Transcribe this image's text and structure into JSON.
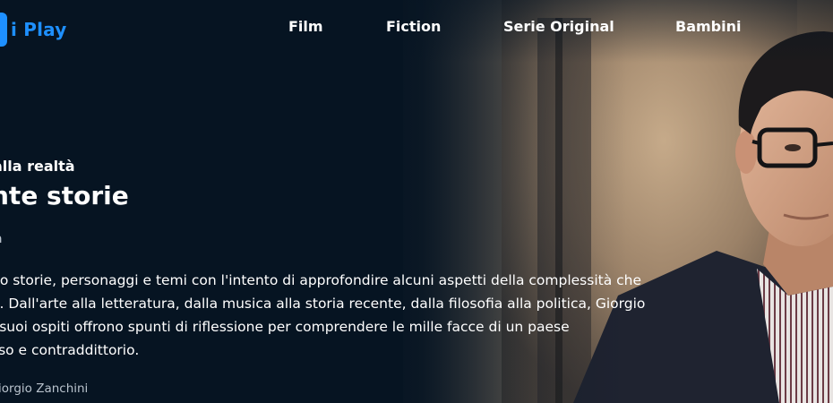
{
  "header": {
    "logo_text": "i Play",
    "nav": [
      {
        "label": "Film"
      },
      {
        "label": "Fiction"
      },
      {
        "label": "Serie Original"
      },
      {
        "label": "Bambini"
      }
    ]
  },
  "hero": {
    "kicker": "alla realtà",
    "title": "nte storie",
    "genre": "a",
    "description_lines": [
      "no storie, personaggi e temi con l'intento di approfondire alcuni aspetti della complessità che",
      "a. Dall'arte alla letteratura, dalla musica alla storia recente, dalla filosofia alla politica, Giorgio",
      "i suoi ospiti offrono spunti di riflessione per comprendere le mille facce di un paese",
      "sso e contraddittorio."
    ],
    "credits": "iorgio Zanchini"
  },
  "colors": {
    "background": "#061422",
    "brand_blue": "#1e90ff",
    "muted_text": "#b9c3cd"
  }
}
